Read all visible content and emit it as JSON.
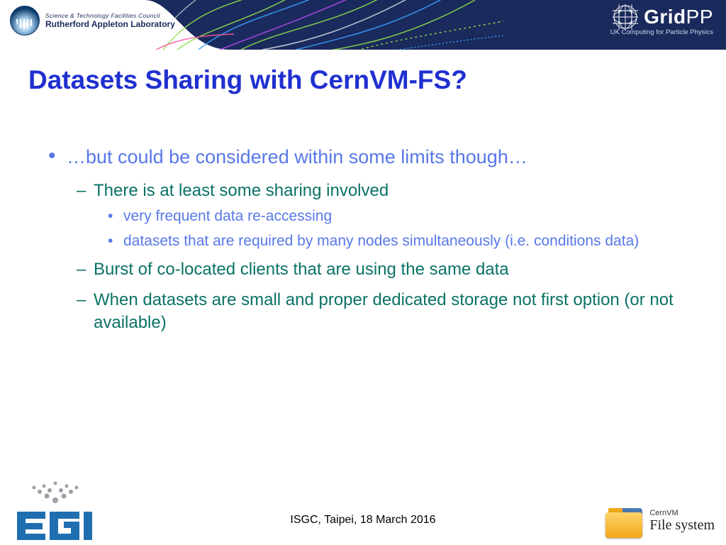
{
  "header": {
    "ral_line1": "Science & Technology Facilities Council",
    "ral_line2": "Rutherford Appleton Laboratory",
    "gridpp_bold": "Grid",
    "gridpp_thin": "PP",
    "gridpp_sub": "UK Computing for Particle Physics"
  },
  "title": "Datasets Sharing with CernVM-FS?",
  "bullets": {
    "l1": "…but could be considered within some limits though…",
    "l2a": "There is at least some sharing involved",
    "l3a": "very frequent data re-accessing",
    "l3b": "datasets that are required by many nodes simultaneously (i.e. conditions data)",
    "l2b": "Burst of co-located clients that are using the same data",
    "l2c": "When datasets are small and proper dedicated storage not first option (or not available)"
  },
  "footer": {
    "text": "ISGC, Taipei, 18 March 2016",
    "cvmfs_line1": "CernVM",
    "cvmfs_line2": "File system"
  }
}
